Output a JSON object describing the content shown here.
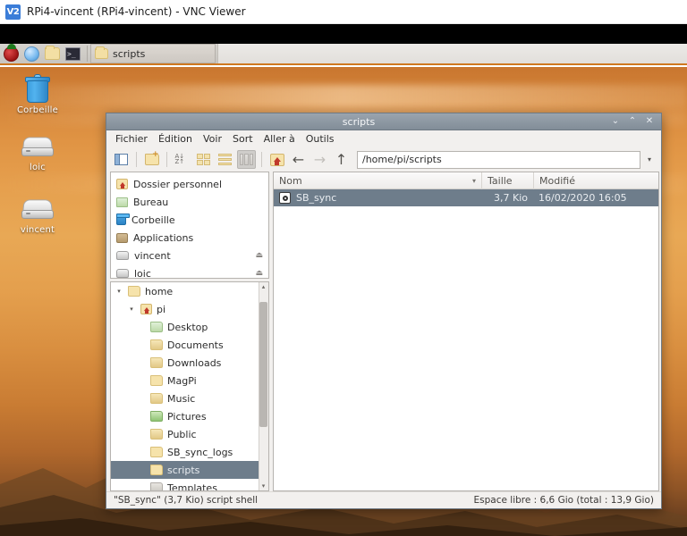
{
  "vnc": {
    "logo_text": "V2",
    "title": "RPi4-vincent (RPi4-vincent) - VNC Viewer"
  },
  "taskbar": {
    "launchers": [
      {
        "name": "raspberry-menu",
        "label": "Menu"
      },
      {
        "name": "web-browser",
        "label": "Navigateur Web"
      },
      {
        "name": "file-manager",
        "label": "Gestionnaire de fichiers"
      },
      {
        "name": "terminal",
        "label": "Terminal"
      }
    ],
    "windows": [
      {
        "label": "scripts"
      }
    ]
  },
  "desktop": {
    "icons": [
      {
        "label": "Corbeille",
        "icon": "trash-icon"
      },
      {
        "label": "loic",
        "icon": "drive-icon"
      },
      {
        "label": "vincent",
        "icon": "drive-icon"
      }
    ]
  },
  "window": {
    "title": "scripts",
    "buttons": {
      "minimize": "⌄",
      "maximize": "⌃",
      "close": "✕"
    },
    "menu": [
      "Fichier",
      "Édition",
      "Voir",
      "Sort",
      "Aller à",
      "Outils"
    ],
    "toolbar": [
      {
        "name": "toggle-side-pane-button",
        "icon": "panes-icon"
      },
      {
        "name": "new-folder-button",
        "icon": "new-folder-icon"
      },
      {
        "name": "sort-button",
        "icon": "sort-az-icon"
      },
      {
        "name": "icon-view-button",
        "icon": "grid-view-icon"
      },
      {
        "name": "compact-view-button",
        "icon": "list-view-icon"
      },
      {
        "name": "detailed-view-button",
        "icon": "detail-view-icon"
      },
      {
        "name": "home-button",
        "icon": "home-icon"
      }
    ],
    "nav": {
      "back": "←",
      "forward": "→",
      "up": "↑"
    },
    "path": "/home/pi/scripts",
    "path_dropdown": "▾"
  },
  "places": {
    "items": [
      {
        "label": "Dossier personnel",
        "icon": "home-icon",
        "eject": false
      },
      {
        "label": "Bureau",
        "icon": "desktop-icon",
        "eject": false
      },
      {
        "label": "Corbeille",
        "icon": "trash-icon",
        "eject": false
      },
      {
        "label": "Applications",
        "icon": "applications-icon",
        "eject": false
      },
      {
        "label": "vincent",
        "icon": "drive-icon",
        "eject": true
      },
      {
        "label": "loic",
        "icon": "drive-icon",
        "eject": true
      }
    ],
    "eject_glyph": "⏏"
  },
  "tree": {
    "items": [
      {
        "label": "home",
        "depth": 0,
        "twisty": "▾",
        "kind": "folder",
        "selected": false
      },
      {
        "label": "pi",
        "depth": 1,
        "twisty": "▾",
        "kind": "home",
        "selected": false
      },
      {
        "label": "Desktop",
        "depth": 2,
        "twisty": "",
        "kind": "desk",
        "selected": false
      },
      {
        "label": "Documents",
        "depth": 2,
        "twisty": "",
        "kind": "doc",
        "selected": false
      },
      {
        "label": "Downloads",
        "depth": 2,
        "twisty": "",
        "kind": "dl",
        "selected": false
      },
      {
        "label": "MagPi",
        "depth": 2,
        "twisty": "",
        "kind": "folder",
        "selected": false
      },
      {
        "label": "Music",
        "depth": 2,
        "twisty": "",
        "kind": "music",
        "selected": false
      },
      {
        "label": "Pictures",
        "depth": 2,
        "twisty": "",
        "kind": "pic",
        "selected": false
      },
      {
        "label": "Public",
        "depth": 2,
        "twisty": "",
        "kind": "pub",
        "selected": false
      },
      {
        "label": "SB_sync_logs",
        "depth": 2,
        "twisty": "",
        "kind": "folder",
        "selected": false
      },
      {
        "label": "scripts",
        "depth": 2,
        "twisty": "",
        "kind": "folder",
        "selected": true
      },
      {
        "label": "Templates",
        "depth": 2,
        "twisty": "",
        "kind": "tpl",
        "selected": false
      }
    ],
    "scroll_up": "▴",
    "scroll_down": "▾"
  },
  "filelist": {
    "columns": [
      {
        "label": "Nom",
        "sort": "▾"
      },
      {
        "label": "Taille"
      },
      {
        "label": "Modifié"
      }
    ],
    "rows": [
      {
        "name": "SB_sync",
        "size": "3,7 Kio",
        "modified": "16/02/2020 16:05",
        "icon": "script-icon",
        "selected": true
      }
    ]
  },
  "status": {
    "left": "\"SB_sync\" (3,7 Kio) script shell",
    "right": "Espace libre : 6,6 Gio (total : 13,9 Gio)"
  }
}
